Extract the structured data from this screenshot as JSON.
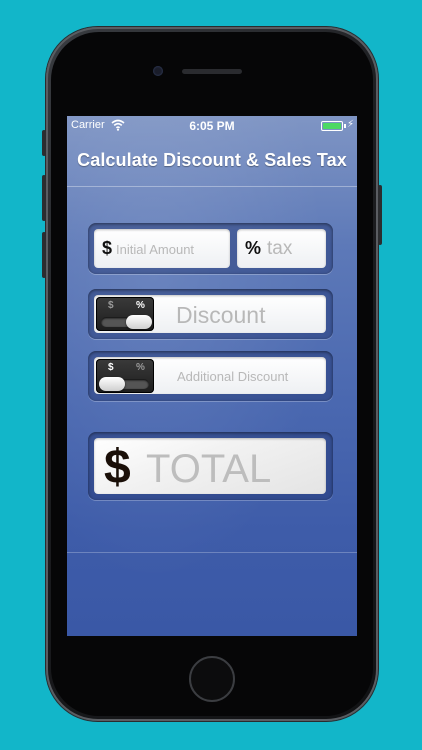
{
  "status_bar": {
    "carrier": "Carrier",
    "time": "6:05 PM"
  },
  "nav": {
    "title": "Calculate Discount & Sales Tax"
  },
  "form": {
    "initial_amount": {
      "symbol": "$",
      "placeholder": "Initial Amount"
    },
    "tax": {
      "symbol": "%",
      "placeholder": "tax"
    },
    "discount": {
      "toggle": {
        "left_label": "$",
        "right_label": "%",
        "selected": "%"
      },
      "placeholder": "Discount"
    },
    "additional_discount": {
      "toggle": {
        "left_label": "$",
        "right_label": "%",
        "selected": "$"
      },
      "placeholder": "Additional Discount"
    },
    "total": {
      "symbol": "$",
      "placeholder": "TOTAL"
    }
  },
  "colors": {
    "background": "#12b6c9",
    "battery": "#4cd964",
    "screen_blue": "#4a68b0"
  }
}
